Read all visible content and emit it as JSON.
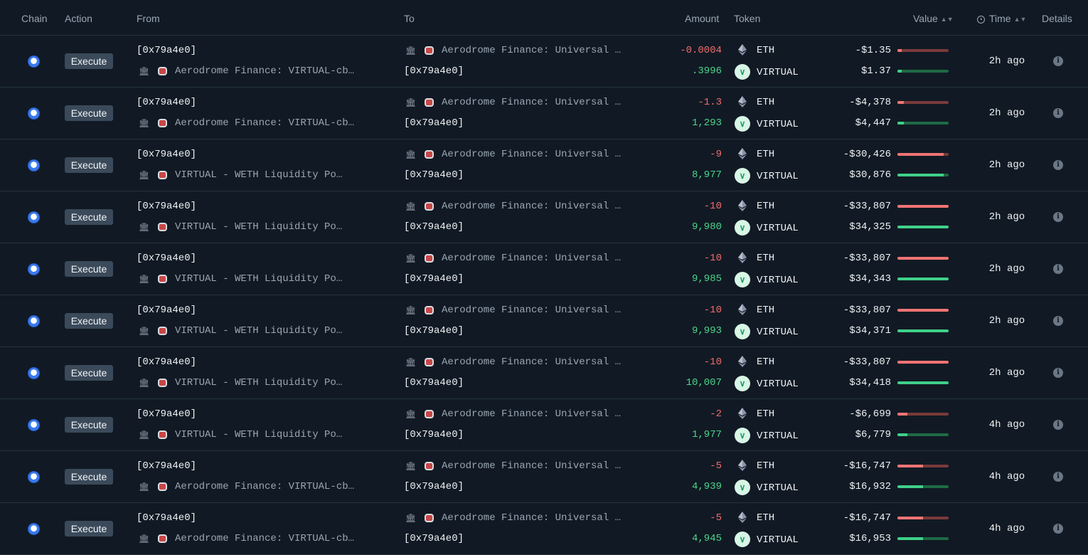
{
  "headers": {
    "chain": "Chain",
    "action": "Action",
    "from": "From",
    "to": "To",
    "amount": "Amount",
    "token": "Token",
    "value": "Value",
    "time": "Time",
    "details": "Details"
  },
  "colors": {
    "negative": "#f06b6b",
    "positive": "#4cd48a",
    "button_bg": "#3b4a5a"
  },
  "rows": [
    {
      "action": "Execute",
      "from_top": "[0x79a4e0]",
      "from_bottom": "Aerodrome Finance: VIRTUAL-cb…",
      "to_top": "Aerodrome Finance: Universal …",
      "to_bottom": "[0x79a4e0]",
      "amount_out": "-0.0004",
      "amount_in": ".3996",
      "token_out": "ETH",
      "token_in": "VIRTUAL",
      "value_out": "-$1.35",
      "value_in": "$1.37",
      "bar_out": 0.02,
      "bar_in": 0.02,
      "time": "2h ago"
    },
    {
      "action": "Execute",
      "from_top": "[0x79a4e0]",
      "from_bottom": "Aerodrome Finance: VIRTUAL-cb…",
      "to_top": "Aerodrome Finance: Universal …",
      "to_bottom": "[0x79a4e0]",
      "amount_out": "-1.3",
      "amount_in": "1,293",
      "token_out": "ETH",
      "token_in": "VIRTUAL",
      "value_out": "-$4,378",
      "value_in": "$4,447",
      "bar_out": 0.13,
      "bar_in": 0.13,
      "time": "2h ago"
    },
    {
      "action": "Execute",
      "from_top": "[0x79a4e0]",
      "from_bottom": "VIRTUAL - WETH Liquidity Po…",
      "to_top": "Aerodrome Finance: Universal …",
      "to_bottom": "[0x79a4e0]",
      "amount_out": "-9",
      "amount_in": "8,977",
      "token_out": "ETH",
      "token_in": "VIRTUAL",
      "value_out": "-$30,426",
      "value_in": "$30,876",
      "bar_out": 0.9,
      "bar_in": 0.9,
      "time": "2h ago"
    },
    {
      "action": "Execute",
      "from_top": "[0x79a4e0]",
      "from_bottom": "VIRTUAL - WETH Liquidity Po…",
      "to_top": "Aerodrome Finance: Universal …",
      "to_bottom": "[0x79a4e0]",
      "amount_out": "-10",
      "amount_in": "9,980",
      "token_out": "ETH",
      "token_in": "VIRTUAL",
      "value_out": "-$33,807",
      "value_in": "$34,325",
      "bar_out": 1.0,
      "bar_in": 1.0,
      "time": "2h ago"
    },
    {
      "action": "Execute",
      "from_top": "[0x79a4e0]",
      "from_bottom": "VIRTUAL - WETH Liquidity Po…",
      "to_top": "Aerodrome Finance: Universal …",
      "to_bottom": "[0x79a4e0]",
      "amount_out": "-10",
      "amount_in": "9,985",
      "token_out": "ETH",
      "token_in": "VIRTUAL",
      "value_out": "-$33,807",
      "value_in": "$34,343",
      "bar_out": 1.0,
      "bar_in": 1.0,
      "time": "2h ago"
    },
    {
      "action": "Execute",
      "from_top": "[0x79a4e0]",
      "from_bottom": "VIRTUAL - WETH Liquidity Po…",
      "to_top": "Aerodrome Finance: Universal …",
      "to_bottom": "[0x79a4e0]",
      "amount_out": "-10",
      "amount_in": "9,993",
      "token_out": "ETH",
      "token_in": "VIRTUAL",
      "value_out": "-$33,807",
      "value_in": "$34,371",
      "bar_out": 1.0,
      "bar_in": 1.0,
      "time": "2h ago"
    },
    {
      "action": "Execute",
      "from_top": "[0x79a4e0]",
      "from_bottom": "VIRTUAL - WETH Liquidity Po…",
      "to_top": "Aerodrome Finance: Universal …",
      "to_bottom": "[0x79a4e0]",
      "amount_out": "-10",
      "amount_in": "10,007",
      "token_out": "ETH",
      "token_in": "VIRTUAL",
      "value_out": "-$33,807",
      "value_in": "$34,418",
      "bar_out": 1.0,
      "bar_in": 1.0,
      "time": "2h ago"
    },
    {
      "action": "Execute",
      "from_top": "[0x79a4e0]",
      "from_bottom": "VIRTUAL - WETH Liquidity Po…",
      "to_top": "Aerodrome Finance: Universal …",
      "to_bottom": "[0x79a4e0]",
      "amount_out": "-2",
      "amount_in": "1,977",
      "token_out": "ETH",
      "token_in": "VIRTUAL",
      "value_out": "-$6,699",
      "value_in": "$6,779",
      "bar_out": 0.2,
      "bar_in": 0.2,
      "time": "4h ago"
    },
    {
      "action": "Execute",
      "from_top": "[0x79a4e0]",
      "from_bottom": "Aerodrome Finance: VIRTUAL-cb…",
      "to_top": "Aerodrome Finance: Universal …",
      "to_bottom": "[0x79a4e0]",
      "amount_out": "-5",
      "amount_in": "4,939",
      "token_out": "ETH",
      "token_in": "VIRTUAL",
      "value_out": "-$16,747",
      "value_in": "$16,932",
      "bar_out": 0.5,
      "bar_in": 0.5,
      "time": "4h ago"
    },
    {
      "action": "Execute",
      "from_top": "[0x79a4e0]",
      "from_bottom": "Aerodrome Finance: VIRTUAL-cb…",
      "to_top": "Aerodrome Finance: Universal …",
      "to_bottom": "[0x79a4e0]",
      "amount_out": "-5",
      "amount_in": "4,945",
      "token_out": "ETH",
      "token_in": "VIRTUAL",
      "value_out": "-$16,747",
      "value_in": "$16,953",
      "bar_out": 0.5,
      "bar_in": 0.5,
      "time": "4h ago"
    }
  ]
}
